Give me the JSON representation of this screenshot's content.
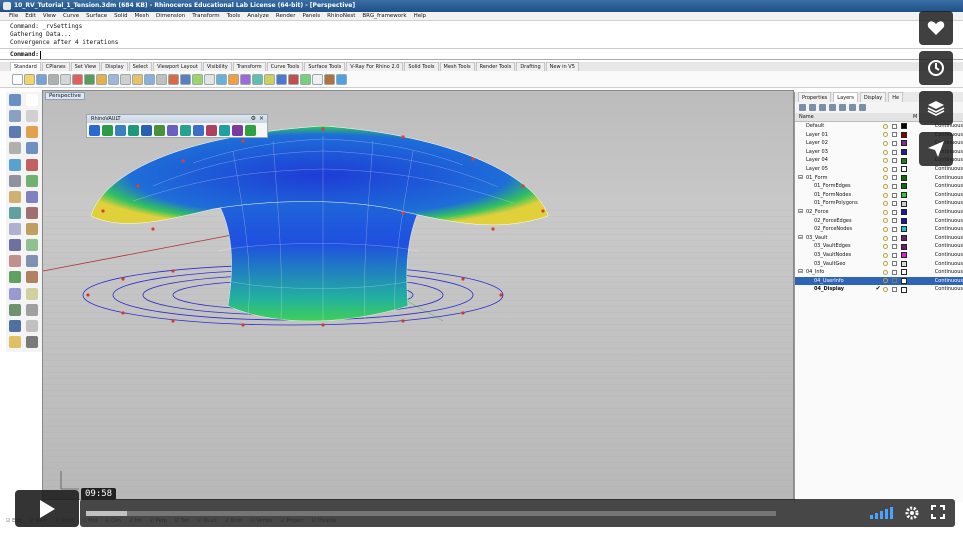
{
  "window": {
    "title": "10_RV_Tutorial_1_Tension.3dm (684 KB) - Rhinoceros Educational Lab License (64-bit) - [Perspective]"
  },
  "menu": [
    "File",
    "Edit",
    "View",
    "Curve",
    "Surface",
    "Solid",
    "Mesh",
    "Dimension",
    "Transform",
    "Tools",
    "Analyze",
    "Render",
    "Panels",
    "RhinoNest",
    "BRG_framework",
    "Help"
  ],
  "command_history": [
    "Command: _rvSettings",
    "Gathering Data...",
    "Convergence after 4 iterations"
  ],
  "command_prompt": "Command:",
  "toolbar_tabs": [
    "Standard",
    "CPlanes",
    "Set View",
    "Display",
    "Select",
    "Viewport Layout",
    "Visibility",
    "Transform",
    "Curve Tools",
    "Surface Tools",
    "V-Ray For Rhino 2.0",
    "Solid Tools",
    "Mesh Tools",
    "Render Tools",
    "Drafting",
    "New in V5"
  ],
  "viewport": {
    "label": "Perspective"
  },
  "rhinovault": {
    "title": "RhinoVAULT"
  },
  "right_panel": {
    "tabs": [
      "Properties",
      "Layers",
      "Display",
      "He"
    ],
    "col_name": "Name",
    "col_material": "M",
    "layers": [
      {
        "name": "Default",
        "color": "#000000",
        "ltype": "Continuous",
        "indent": 0
      },
      {
        "name": "Layer 01",
        "color": "#8b0000",
        "ltype": "Continuous",
        "indent": 0
      },
      {
        "name": "Layer 02",
        "color": "#8b2a8b",
        "ltype": "Continuous",
        "indent": 0
      },
      {
        "name": "Layer 03",
        "color": "#1e1e9e",
        "ltype": "Continuous",
        "indent": 0
      },
      {
        "name": "Layer 04",
        "color": "#1e7f1e",
        "ltype": "Continuous",
        "indent": 0
      },
      {
        "name": "Layer 05",
        "color": "#ffffff",
        "ltype": "Continuous",
        "indent": 0
      },
      {
        "name": "01_Form",
        "color": "#0f6b0f",
        "ltype": "Continuous",
        "indent": 0,
        "expanded": true
      },
      {
        "name": "01_FormEdges",
        "color": "#0f6b0f",
        "ltype": "Continuous",
        "indent": 1
      },
      {
        "name": "01_FormNodes",
        "color": "#2bc92b",
        "ltype": "Continuous",
        "indent": 1
      },
      {
        "name": "01_FormPolygons",
        "color": "#cfcfcf",
        "ltype": "Continuous",
        "indent": 1
      },
      {
        "name": "02_Force",
        "color": "#1919a8",
        "ltype": "Continuous",
        "indent": 0,
        "expanded": true
      },
      {
        "name": "02_ForceEdges",
        "color": "#1919a8",
        "ltype": "Continuous",
        "indent": 1
      },
      {
        "name": "02_ForceNodes",
        "color": "#22c0d0",
        "ltype": "Continuous",
        "indent": 1
      },
      {
        "name": "03_Vault",
        "color": "#6e1e6e",
        "ltype": "Continuous",
        "indent": 0,
        "expanded": true
      },
      {
        "name": "03_VaultEdges",
        "color": "#6e1e6e",
        "ltype": "Continuous",
        "indent": 1
      },
      {
        "name": "03_VaultNodes",
        "color": "#e020d0",
        "ltype": "Continuous",
        "indent": 1
      },
      {
        "name": "03_VaultGeo",
        "color": "#d8d8d8",
        "ltype": "Continuous",
        "indent": 1
      },
      {
        "name": "04_Info",
        "color": "#ffffff",
        "ltype": "Continuous",
        "indent": 0,
        "expanded": true
      },
      {
        "name": "04_UserInfo",
        "color": "#ffffff",
        "ltype": "Continuous",
        "indent": 1,
        "selected": true
      },
      {
        "name": "04_Display",
        "color": "#ffffff",
        "ltype": "Continuous",
        "indent": 1,
        "current": true
      }
    ]
  },
  "osnap": [
    "End",
    "Near",
    "Point",
    "Mid",
    "Cen",
    "Int",
    "Perp",
    "Tan",
    "Quad",
    "Knot",
    "Vertex",
    "Project",
    "Disable"
  ],
  "video": {
    "time": "09:58",
    "progress": 0.06
  },
  "colors": {
    "accent": "#2f63b5"
  }
}
